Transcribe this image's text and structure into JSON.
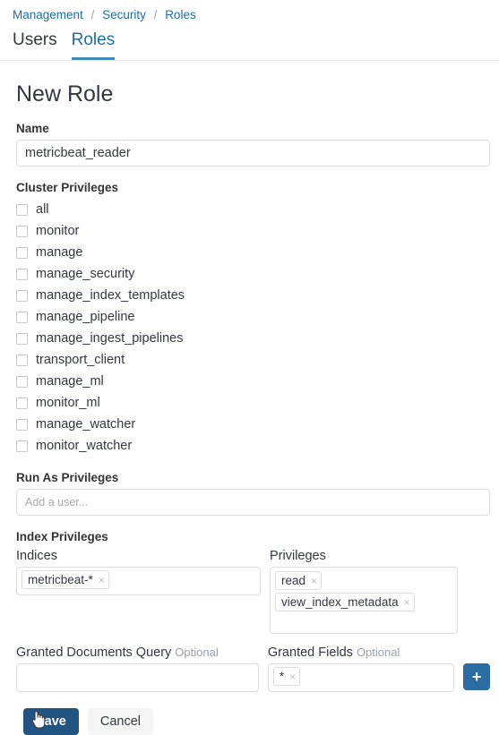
{
  "breadcrumb": {
    "items": [
      "Management",
      "Security",
      "Roles"
    ],
    "separator": "/"
  },
  "tabs": [
    {
      "label": "Users",
      "active": false
    },
    {
      "label": "Roles",
      "active": true
    }
  ],
  "page": {
    "title": "New Role"
  },
  "name_field": {
    "label": "Name",
    "value": "metricbeat_reader",
    "placeholder": ""
  },
  "cluster_privileges": {
    "label": "Cluster Privileges",
    "items": [
      {
        "label": "all",
        "checked": false
      },
      {
        "label": "monitor",
        "checked": false
      },
      {
        "label": "manage",
        "checked": false
      },
      {
        "label": "manage_security",
        "checked": false
      },
      {
        "label": "manage_index_templates",
        "checked": false
      },
      {
        "label": "manage_pipeline",
        "checked": false
      },
      {
        "label": "manage_ingest_pipelines",
        "checked": false
      },
      {
        "label": "transport_client",
        "checked": false
      },
      {
        "label": "manage_ml",
        "checked": false
      },
      {
        "label": "monitor_ml",
        "checked": false
      },
      {
        "label": "manage_watcher",
        "checked": false
      },
      {
        "label": "monitor_watcher",
        "checked": false
      }
    ]
  },
  "run_as_privileges": {
    "label": "Run As Privileges",
    "value": "",
    "placeholder": "Add a user..."
  },
  "index_privileges": {
    "label": "Index Privileges",
    "indices": {
      "label": "Indices",
      "pills": [
        "metricbeat-*"
      ]
    },
    "privileges": {
      "label": "Privileges",
      "pills": [
        "read",
        "view_index_metadata"
      ]
    },
    "granted_documents_query": {
      "label": "Granted Documents Query",
      "optional": "Optional",
      "value": ""
    },
    "granted_fields": {
      "label": "Granted Fields",
      "optional": "Optional",
      "pills": [
        "*"
      ]
    },
    "add_button": "+"
  },
  "footer": {
    "save_label": "Save",
    "cancel_label": "Cancel"
  },
  "icons": {
    "pill_remove": "×"
  },
  "colors": {
    "link": "#1c6ea5",
    "tab_active": "#1c6ea5",
    "tab_underline": "#3f87b5",
    "save_button": "#215480",
    "add_button": "#2b6ca3",
    "border": "#dddddd"
  }
}
